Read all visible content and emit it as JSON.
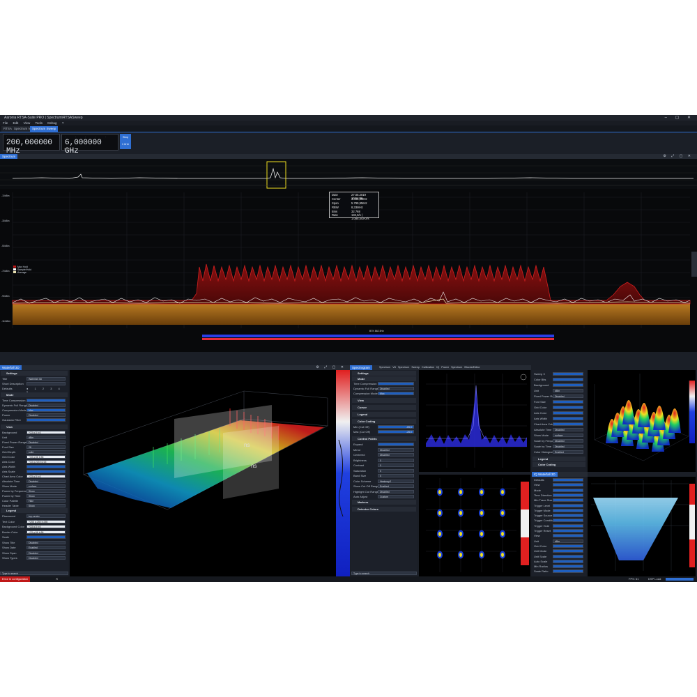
{
  "window": {
    "title": "Aaronia RTSA-Suite PRO | Spectrum\\RTSASweep",
    "controls": "– ▢ ✕"
  },
  "menu": [
    "File",
    "Edit",
    "View",
    "Tools",
    "Debug",
    "?"
  ],
  "tabs": [
    "RTSA",
    "Spectrum V6",
    "Spectrum Sweep"
  ],
  "active_tab": 2,
  "frequency": {
    "center": "200,000000 MHz",
    "span": "6,000000 GHz",
    "stop_label": "Stop",
    "unit_label": "1 kHz",
    "span_caption": "Span"
  },
  "overview_panel": {
    "label": "Spectrum"
  },
  "info_box": {
    "rows": [
      {
        "k": "Date",
        "v": "27.05.2019 10:54:06"
      },
      {
        "k": "Center",
        "v": "3.099,9MHz"
      },
      {
        "k": "Span",
        "v": "5.799,9MHz"
      },
      {
        "k": "RBW",
        "v": "8,33MHz"
      },
      {
        "k": "Bins",
        "v": "32.768"
      },
      {
        "k": "Rate",
        "v": "192,0/s | 1.055,4GHz/s"
      }
    ]
  },
  "legend": [
    "Max Hold",
    "Sample/Hold",
    "Average"
  ],
  "colors": {
    "accent": "#2f6fd3",
    "maxhold": "#c01818",
    "average": "#e8e0b0",
    "background": "#1b1f27",
    "noise_floor": "#a86a18"
  },
  "band_label": "BTK 862.5Hz",
  "waterfall3d": {
    "tab": "Waterfall 3D",
    "settings_title": "Settings",
    "rows": [
      {
        "label": "Title",
        "value": "Waterfall 3D"
      },
      {
        "label": "Short Description",
        "value": ""
      },
      {
        "label": "Defaults",
        "value": ""
      }
    ],
    "mode_section": "Mode",
    "mode_rows": [
      {
        "label": "Time Compression",
        "value": ""
      },
      {
        "label": "Dynamic Full Range",
        "value": "Disabled"
      },
      {
        "label": "Compression Mode",
        "value": "Max"
      },
      {
        "label": "Power",
        "value": "Disabled"
      },
      {
        "label": "Gaussian Filter",
        "value": ""
      }
    ],
    "view_section": "View",
    "view_rows": [
      {
        "label": "Background",
        "value": "+33 g:3 b:0"
      },
      {
        "label": "Unit",
        "value": "dBm"
      },
      {
        "label": "Fixed Power Range",
        "value": "Disabled"
      },
      {
        "label": "Font Size",
        "value": "28"
      },
      {
        "label": "Grid Depth",
        "value": "solid"
      },
      {
        "label": "Grid Color",
        "value": "+33 g:56 b:56"
      },
      {
        "label": "Axis Color",
        "value": "+33 g:215 b:215"
      },
      {
        "label": "Axis Width",
        "value": ""
      },
      {
        "label": "Axis Scale",
        "value": ""
      },
      {
        "label": "Chart Area Color",
        "value": "+33 g:3 b:0"
      },
      {
        "label": "Absolute Time",
        "value": "Disabled"
      },
      {
        "label": "Show Mode",
        "value": "surface"
      },
      {
        "label": "Power by Frequency",
        "value": "Show"
      },
      {
        "label": "Power by Time",
        "value": "Show"
      },
      {
        "label": "Color Palette",
        "value": "Hide"
      },
      {
        "label": "Header Table",
        "value": "Show"
      }
    ],
    "legend_section": "Legend",
    "legend_rows": [
      {
        "label": "Placement",
        "value": "top-center"
      },
      {
        "label": "Text Color",
        "value": "+255 g:255 b:255"
      },
      {
        "label": "Background Color",
        "value": "+33 g:3 b:0"
      },
      {
        "label": "Border Color",
        "value": "+33 g:56 b:56"
      },
      {
        "label": "Scale",
        "value": ""
      },
      {
        "label": "Show Title",
        "value": "Disabled"
      },
      {
        "label": "Show Date",
        "value": "Enabled"
      },
      {
        "label": "Show Span",
        "value": "Disabled"
      },
      {
        "label": "Show Types",
        "value": "Disabled"
      }
    ],
    "search_placeholder": "Type to search"
  },
  "spectrogram_panel": {
    "tabs": [
      "Spectrogram",
      "Spectrum V6",
      "Spectrum Sweep",
      "Calibration",
      "IQ Power Spectrum",
      "Blocks/Editor"
    ],
    "settings_title": "Settings",
    "mode_section": "Mode",
    "rows": [
      {
        "label": "Time Compression",
        "value": ""
      },
      {
        "label": "Dynamic Full Range",
        "value": "Disabled"
      },
      {
        "label": "Compression Mode",
        "value": "Max"
      }
    ],
    "sections": [
      "View",
      "Cursor",
      "Legend",
      "Color Coding"
    ],
    "color_rows": [
      {
        "label": "Min (Cut Off)",
        "value": "-85,0"
      },
      {
        "label": "Max (Cut Off)",
        "value": "-26,0"
      }
    ],
    "control_section": "Control Points",
    "control_rows": [
      {
        "label": "Expand",
        "value": ""
      },
      {
        "label": "Mirror",
        "value": "Disabled"
      },
      {
        "label": "Centered",
        "value": "Disabled"
      },
      {
        "label": "Brightness",
        "value": "0"
      },
      {
        "label": "Contrast",
        "value": "0"
      },
      {
        "label": "Saturation",
        "value": "0"
      },
      {
        "label": "Band Size",
        "value": "0"
      },
      {
        "label": "Color Scheme",
        "value": "Heatmap2"
      },
      {
        "label": "Show Cut Off Ranges",
        "value": "Enabled"
      },
      {
        "label": "Highlight Out Ranges",
        "value": "Disabled"
      },
      {
        "label": "Auto Adjust",
        "value": "Custom"
      }
    ],
    "bottom_sections": [
      "Markers",
      "Detector Colors"
    ],
    "search_placeholder": "Type to search"
  },
  "right_settings": {
    "sections": [
      "View",
      "Legend",
      "Color Coding"
    ],
    "rows": [
      {
        "label": "Sweep X",
        "value": ""
      },
      {
        "label": "Color Bits",
        "value": ""
      },
      {
        "label": "Background",
        "value": ""
      },
      {
        "label": "Unit",
        "value": "dBm"
      },
      {
        "label": "Fixed Power Range",
        "value": "Disabled"
      },
      {
        "label": "Font Size",
        "value": ""
      },
      {
        "label": "Grid Color",
        "value": ""
      },
      {
        "label": "Axis Color",
        "value": ""
      },
      {
        "label": "Axis Width",
        "value": ""
      },
      {
        "label": "Chart Area Color",
        "value": ""
      },
      {
        "label": "Absolute Time",
        "value": "Disabled"
      },
      {
        "label": "Show Mode",
        "value": "surface"
      },
      {
        "label": "Scale by Frequency",
        "value": "Disabled"
      },
      {
        "label": "Scale by Time",
        "value": "Disabled"
      },
      {
        "label": "Color Histogram",
        "value": "Enabled"
      }
    ]
  },
  "right_settings2": {
    "tab": "IQ Waterfall 3D",
    "rows": [
      {
        "label": "Defaults",
        "value": ""
      },
      {
        "label": "View",
        "value": ""
      },
      {
        "label": "Mode",
        "value": ""
      },
      {
        "label": "Time Direction",
        "value": ""
      },
      {
        "label": "Min Trace Size",
        "value": ""
      },
      {
        "label": "Trigger Level",
        "value": ""
      },
      {
        "label": "Trigger Mode",
        "value": ""
      },
      {
        "label": "Trigger Source",
        "value": ""
      },
      {
        "label": "Trigger Condition",
        "value": ""
      },
      {
        "label": "Trigger Hold",
        "value": ""
      },
      {
        "label": "Trigger Reset",
        "value": ""
      },
      {
        "label": "View",
        "value": ""
      },
      {
        "label": "Unit",
        "value": "dBm"
      },
      {
        "label": "Grid Color",
        "value": ""
      },
      {
        "label": "Unit Mode",
        "value": ""
      },
      {
        "label": "Unit Scale",
        "value": ""
      },
      {
        "label": "Auto Scale",
        "value": ""
      },
      {
        "label": "Min Radius",
        "value": ""
      },
      {
        "label": "Scale Ratio",
        "value": ""
      }
    ]
  },
  "status": {
    "error": "Error in configuration",
    "fps_label": "FPS: 61",
    "dsp_label": "DSP Load:"
  }
}
